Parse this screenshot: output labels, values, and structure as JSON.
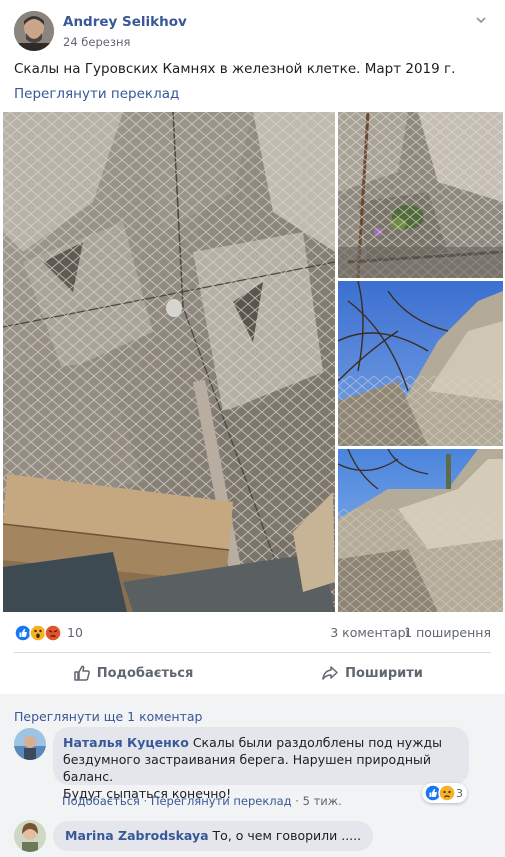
{
  "post": {
    "author": "Andrey Selikhov",
    "date": "24 березня",
    "text": "Скалы на Гуровских Камнях в железной клетке. Март 2019 г.",
    "translate_link": "Переглянути переклад"
  },
  "stats": {
    "reactions": "10",
    "reaction_icons": [
      "like-icon",
      "wow-icon",
      "angry-icon"
    ],
    "comments": "3 коментарі",
    "shares": "1 поширення"
  },
  "actions": {
    "like": "Подобається",
    "share": "Поширити"
  },
  "comments_section": {
    "view_more": "Переглянути ще 1 коментар",
    "comments": [
      {
        "author": "Наталья Куценко",
        "text_line1": "Скалы были раздолблены под нужды",
        "text_line2": "бездумного застраивания берега. Нарушен природный баланс.",
        "text_line3": "Будут сыпаться конечно!",
        "like_action": "Подобається",
        "translate_action": "Переглянути переклад",
        "time": "5 тиж.",
        "reaction_count": "3",
        "reaction_icons": [
          "like-icon",
          "sad-icon"
        ]
      },
      {
        "author": "Marina Zabrodskaya",
        "text": "То, о чем говорили ....."
      }
    ]
  },
  "colors": {
    "link": "#385898",
    "secondary_text": "#606770",
    "comment_bubble": "#e4e6eb",
    "comments_bg": "#f2f3f5"
  }
}
